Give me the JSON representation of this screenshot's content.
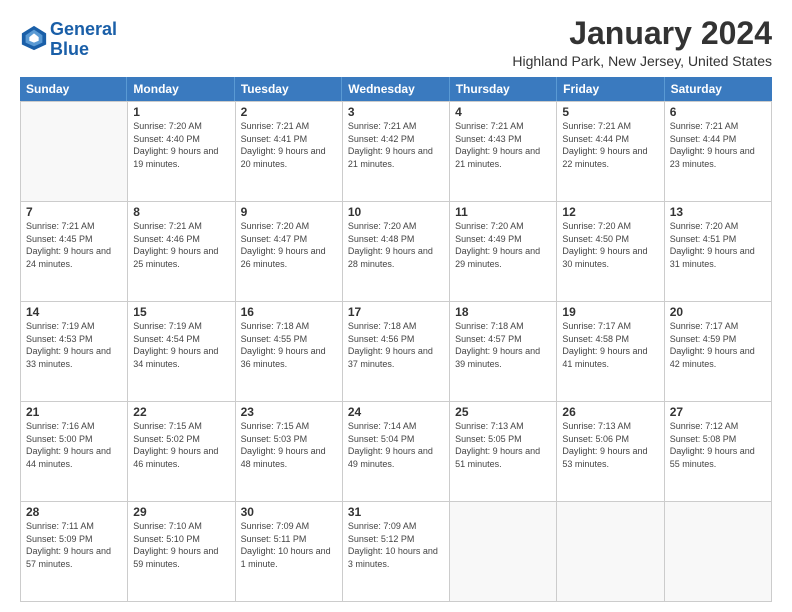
{
  "logo": {
    "line1": "General",
    "line2": "Blue"
  },
  "title": "January 2024",
  "location": "Highland Park, New Jersey, United States",
  "days_of_week": [
    "Sunday",
    "Monday",
    "Tuesday",
    "Wednesday",
    "Thursday",
    "Friday",
    "Saturday"
  ],
  "weeks": [
    [
      {
        "day": "",
        "empty": true
      },
      {
        "day": "1",
        "sunrise": "7:20 AM",
        "sunset": "4:40 PM",
        "daylight": "9 hours and 19 minutes."
      },
      {
        "day": "2",
        "sunrise": "7:21 AM",
        "sunset": "4:41 PM",
        "daylight": "9 hours and 20 minutes."
      },
      {
        "day": "3",
        "sunrise": "7:21 AM",
        "sunset": "4:42 PM",
        "daylight": "9 hours and 21 minutes."
      },
      {
        "day": "4",
        "sunrise": "7:21 AM",
        "sunset": "4:43 PM",
        "daylight": "9 hours and 21 minutes."
      },
      {
        "day": "5",
        "sunrise": "7:21 AM",
        "sunset": "4:44 PM",
        "daylight": "9 hours and 22 minutes."
      },
      {
        "day": "6",
        "sunrise": "7:21 AM",
        "sunset": "4:44 PM",
        "daylight": "9 hours and 23 minutes."
      }
    ],
    [
      {
        "day": "7",
        "sunrise": "7:21 AM",
        "sunset": "4:45 PM",
        "daylight": "9 hours and 24 minutes."
      },
      {
        "day": "8",
        "sunrise": "7:21 AM",
        "sunset": "4:46 PM",
        "daylight": "9 hours and 25 minutes."
      },
      {
        "day": "9",
        "sunrise": "7:20 AM",
        "sunset": "4:47 PM",
        "daylight": "9 hours and 26 minutes."
      },
      {
        "day": "10",
        "sunrise": "7:20 AM",
        "sunset": "4:48 PM",
        "daylight": "9 hours and 28 minutes."
      },
      {
        "day": "11",
        "sunrise": "7:20 AM",
        "sunset": "4:49 PM",
        "daylight": "9 hours and 29 minutes."
      },
      {
        "day": "12",
        "sunrise": "7:20 AM",
        "sunset": "4:50 PM",
        "daylight": "9 hours and 30 minutes."
      },
      {
        "day": "13",
        "sunrise": "7:20 AM",
        "sunset": "4:51 PM",
        "daylight": "9 hours and 31 minutes."
      }
    ],
    [
      {
        "day": "14",
        "sunrise": "7:19 AM",
        "sunset": "4:53 PM",
        "daylight": "9 hours and 33 minutes."
      },
      {
        "day": "15",
        "sunrise": "7:19 AM",
        "sunset": "4:54 PM",
        "daylight": "9 hours and 34 minutes."
      },
      {
        "day": "16",
        "sunrise": "7:18 AM",
        "sunset": "4:55 PM",
        "daylight": "9 hours and 36 minutes."
      },
      {
        "day": "17",
        "sunrise": "7:18 AM",
        "sunset": "4:56 PM",
        "daylight": "9 hours and 37 minutes."
      },
      {
        "day": "18",
        "sunrise": "7:18 AM",
        "sunset": "4:57 PM",
        "daylight": "9 hours and 39 minutes."
      },
      {
        "day": "19",
        "sunrise": "7:17 AM",
        "sunset": "4:58 PM",
        "daylight": "9 hours and 41 minutes."
      },
      {
        "day": "20",
        "sunrise": "7:17 AM",
        "sunset": "4:59 PM",
        "daylight": "9 hours and 42 minutes."
      }
    ],
    [
      {
        "day": "21",
        "sunrise": "7:16 AM",
        "sunset": "5:00 PM",
        "daylight": "9 hours and 44 minutes."
      },
      {
        "day": "22",
        "sunrise": "7:15 AM",
        "sunset": "5:02 PM",
        "daylight": "9 hours and 46 minutes."
      },
      {
        "day": "23",
        "sunrise": "7:15 AM",
        "sunset": "5:03 PM",
        "daylight": "9 hours and 48 minutes."
      },
      {
        "day": "24",
        "sunrise": "7:14 AM",
        "sunset": "5:04 PM",
        "daylight": "9 hours and 49 minutes."
      },
      {
        "day": "25",
        "sunrise": "7:13 AM",
        "sunset": "5:05 PM",
        "daylight": "9 hours and 51 minutes."
      },
      {
        "day": "26",
        "sunrise": "7:13 AM",
        "sunset": "5:06 PM",
        "daylight": "9 hours and 53 minutes."
      },
      {
        "day": "27",
        "sunrise": "7:12 AM",
        "sunset": "5:08 PM",
        "daylight": "9 hours and 55 minutes."
      }
    ],
    [
      {
        "day": "28",
        "sunrise": "7:11 AM",
        "sunset": "5:09 PM",
        "daylight": "9 hours and 57 minutes."
      },
      {
        "day": "29",
        "sunrise": "7:10 AM",
        "sunset": "5:10 PM",
        "daylight": "9 hours and 59 minutes."
      },
      {
        "day": "30",
        "sunrise": "7:09 AM",
        "sunset": "5:11 PM",
        "daylight": "10 hours and 1 minute."
      },
      {
        "day": "31",
        "sunrise": "7:09 AM",
        "sunset": "5:12 PM",
        "daylight": "10 hours and 3 minutes."
      },
      {
        "day": "",
        "empty": true
      },
      {
        "day": "",
        "empty": true
      },
      {
        "day": "",
        "empty": true
      }
    ]
  ]
}
